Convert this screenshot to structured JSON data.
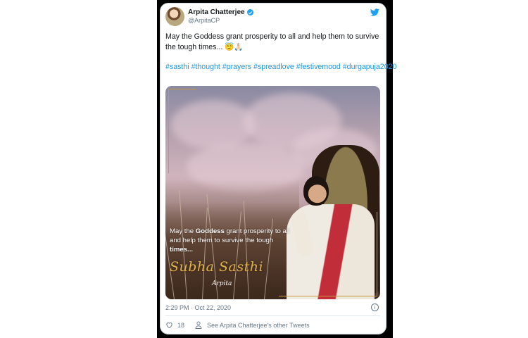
{
  "tweet": {
    "author_name": "Arpita Chatterjee",
    "author_handle": "@ArpitaCP",
    "text": "May the Goddess grant prosperity to all and help them to survive the tough times... 😇🙏🏻",
    "hashtags": [
      "#sasthi",
      "#thought",
      "#prayers",
      "#spreadlove",
      "#festivemood",
      "#durgapuja2020"
    ],
    "timestamp": "2:29 PM · Oct 22, 2020",
    "likes": "18",
    "other_tweets_link": "See Arpita Chatterjee's other Tweets"
  },
  "media": {
    "caption_pre": "May the ",
    "caption_bold1": "Goddess",
    "caption_mid": " grant prosperity to all and help them to survive the tough ",
    "caption_bold2": "times...",
    "title": "Subha Sasthi",
    "signature": "Arpita"
  },
  "icons": {
    "brand": "twitter-bird-icon",
    "verified": "verified-badge-icon",
    "info": "info-icon",
    "like": "heart-icon",
    "profile": "person-icon"
  },
  "colors": {
    "brand_blue": "#1da1f2",
    "hashtag_blue": "#1b95e0",
    "secondary_text": "#657786",
    "title_gold": "#e2b24a"
  }
}
